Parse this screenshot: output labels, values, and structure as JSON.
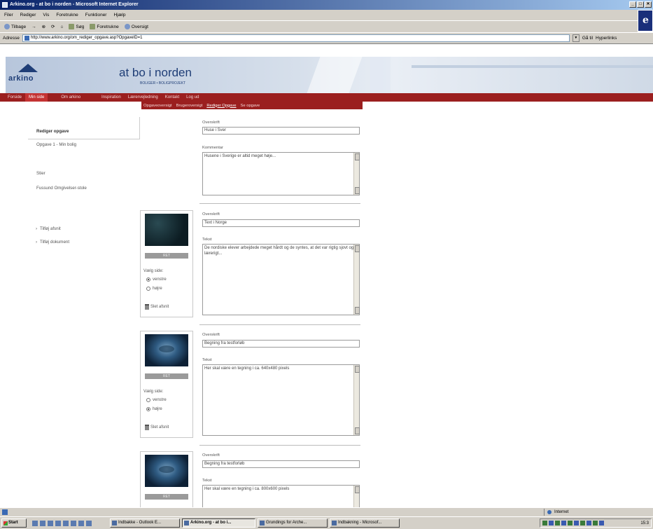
{
  "window": {
    "title": "Arkino.org - at bo i norden - Microsoft Internet Explorer",
    "controls": [
      "_",
      "□",
      "✕"
    ]
  },
  "menu": [
    "Filer",
    "Rediger",
    "Vis",
    "Foretrukne",
    "Funktioner",
    "Hjælp"
  ],
  "toolbar": [
    "Tilbage",
    "→",
    "⊗",
    "⟳",
    "⌂",
    "Søg",
    "Foretrukne",
    "Oversigt"
  ],
  "address": {
    "label": "Adresse",
    "url": "http://www.arkino.org/om_rediger_opgave.asp?OpgaveID=1",
    "go": "Gå til",
    "links": "Hyperlinks"
  },
  "site": {
    "logo": "arkino",
    "title": "at bo i norden",
    "subtitle": "BOLIGER • BOLIGPROJEKT"
  },
  "nav": {
    "main": [
      "Forside",
      "Min side",
      "Om arkino",
      "Inspiration",
      "Lærervejledning",
      "Kontakt",
      "Log ud"
    ],
    "sub": [
      "Opgaveoversigt",
      "Brugeroversigt",
      "Rediger Opgave",
      "Se opgave"
    ]
  },
  "sidebar": {
    "heading": "Rediger opgave",
    "task": "Opgave 1 - Min bolig",
    "links": [
      "Stier",
      "Fussund Omgivelser-stole"
    ],
    "actions": [
      "Tilføj afsnit",
      "Tilføj dokument"
    ]
  },
  "content": {
    "section0": {
      "heading_label": "Overskrift",
      "heading_value": "Huse i Sver",
      "comment_label": "Kommentar",
      "comment_value": "Husene i Sverige er altid meget høje..."
    },
    "sections": [
      {
        "heading_label": "Overskrift",
        "heading_value": "Text i Norge",
        "text_label": "Tekst",
        "text_value": "De nordiske  elever arbejdede meget hårdt og de syntes, at det var rigtig sjovt og lærerigt...",
        "ret_label": "RET",
        "side_label": "Vælg side:",
        "left_label": "venstre",
        "right_label": "højre",
        "side_selected": "left",
        "delete_label": "Slet afsnit"
      },
      {
        "heading_label": "Overskrift",
        "heading_value": "Begning fra testforløb",
        "text_label": "Tekst",
        "text_value": "Her skal være en tegning i ca. 640x480 pixels",
        "ret_label": "RET",
        "side_label": "Vælg side:",
        "left_label": "venstre",
        "right_label": "højre",
        "side_selected": "right",
        "delete_label": "Slet afsnit"
      },
      {
        "heading_label": "Overskrift",
        "heading_value": "Begning fra testforløb",
        "text_label": "Tekst",
        "text_value": "Her skal være en tegning i ca. 800x600 pixels",
        "ret_label": "RET"
      }
    ]
  },
  "status": {
    "zone": "Internet"
  },
  "taskbar": {
    "start": "Start",
    "tasks": [
      "Indbakke - Outlook E...",
      "Arkino.org - at bo i...",
      "Grundings for Arche...",
      "Indbakning - Microsof..."
    ],
    "active_task": 1,
    "clock": "15:3"
  }
}
